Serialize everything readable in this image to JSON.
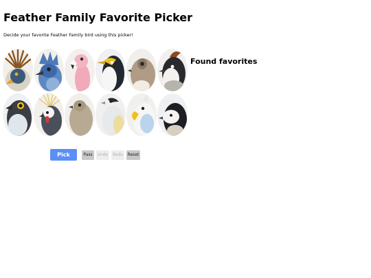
{
  "page": {
    "title": "Feather Family Favorite Picker",
    "subtitle": "Decide your favorite Feather Family bird using this picker!",
    "found_heading": "Found favorites"
  },
  "birds": [
    {
      "icon": "secretarybird-icon",
      "bg": "#f1efe9"
    },
    {
      "icon": "blue-crested-bird-icon",
      "bg": "#f1f0ec"
    },
    {
      "icon": "pink-flamingo-icon",
      "bg": "#f3efee"
    },
    {
      "icon": "penguin-icon",
      "bg": "#eff0f1"
    },
    {
      "icon": "owl-icon",
      "bg": "#f0efec"
    },
    {
      "icon": "crested-bird-icon",
      "bg": "#f1f0ee"
    },
    {
      "icon": "osprey-icon",
      "bg": "#eef0f1"
    },
    {
      "icon": "crowned-crane-icon",
      "bg": "#f1f0ec"
    },
    {
      "icon": "dove-icon",
      "bg": "#f0efec"
    },
    {
      "icon": "white-gull-icon",
      "bg": "#f0f0ef"
    },
    {
      "icon": "cockatoo-icon",
      "bg": "#f0f0ee"
    },
    {
      "icon": "chickadee-icon",
      "bg": "#eff0f1"
    }
  ],
  "controls": {
    "pick": "Pick",
    "pass": "Pass",
    "undo": "Undo",
    "redo": "Redo",
    "reset": "Reset"
  },
  "colors": {
    "pick_button": "#5b8ef7",
    "active_button": "#c8c8c8",
    "disabled_button": "#eeeeee"
  }
}
